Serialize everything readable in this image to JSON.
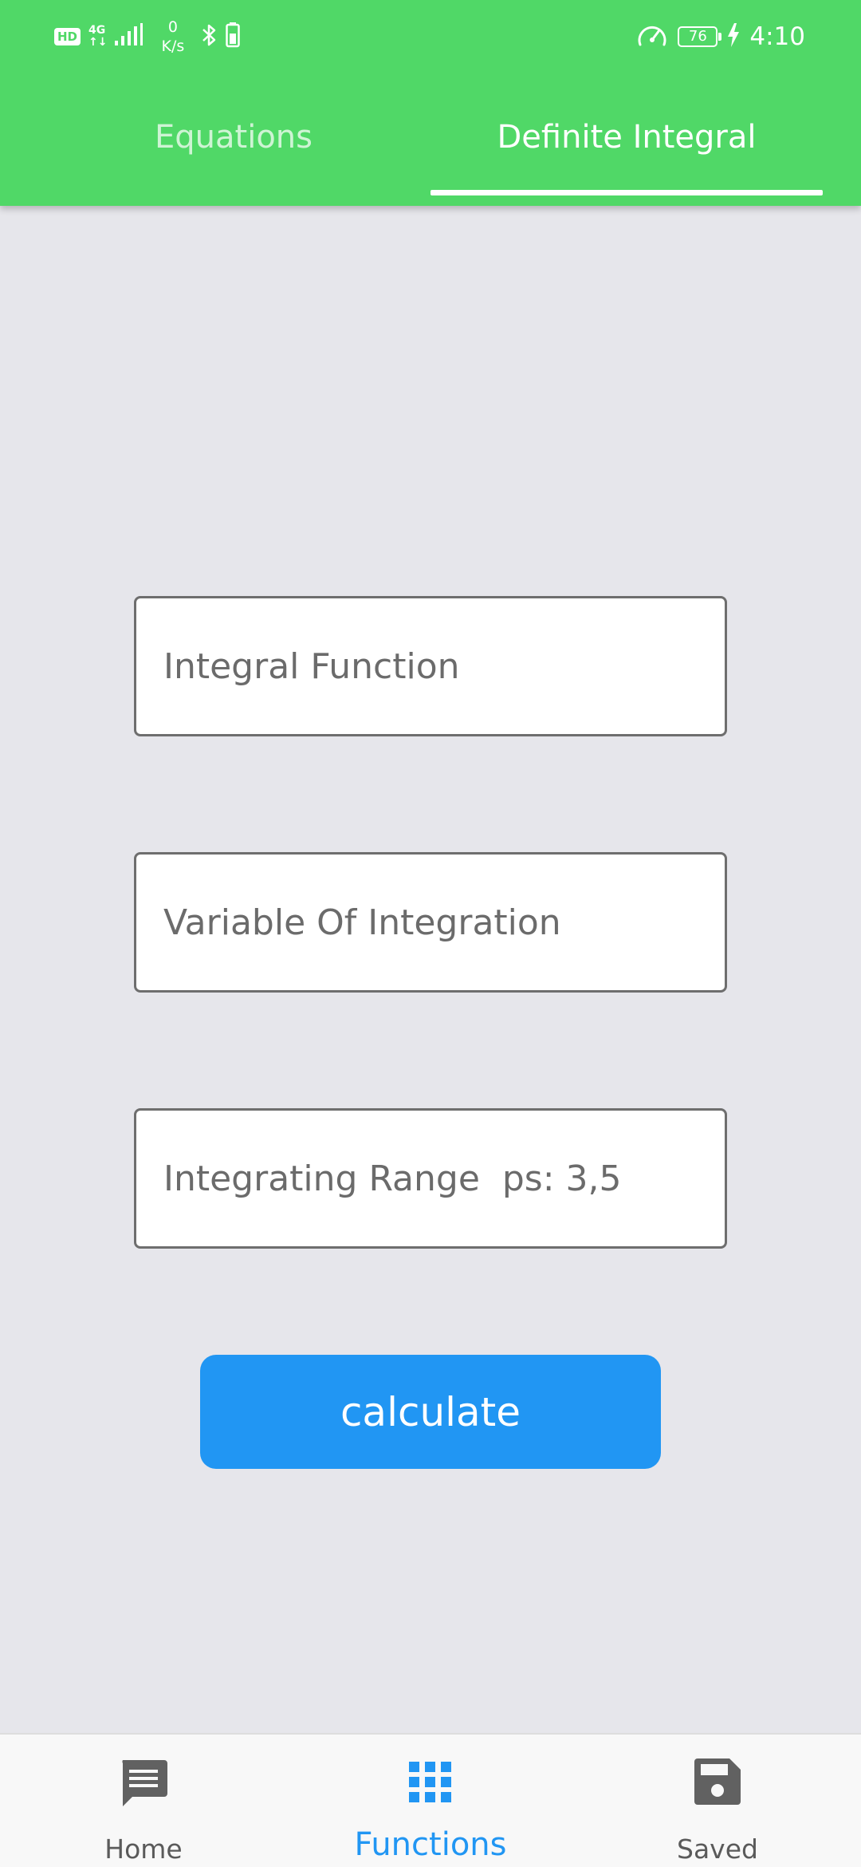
{
  "status_bar": {
    "hd": "HD",
    "network_type_top": "4G",
    "network_type_bottom": "↑↓",
    "speed_value": "0",
    "speed_unit": "K/s",
    "battery_level": "76",
    "time": "4:10"
  },
  "tabs": [
    {
      "label": "Equations",
      "selected": false
    },
    {
      "label": "Definite Integral",
      "selected": true
    }
  ],
  "form": {
    "integral_function": {
      "placeholder": "Integral Function",
      "value": ""
    },
    "variable_of_integration": {
      "placeholder": "Variable Of Integration",
      "value": ""
    },
    "integrating_range": {
      "placeholder": "Integrating Range  ps: 3,5",
      "value": ""
    },
    "calculate_label": "calculate"
  },
  "bottom_nav": {
    "items": [
      {
        "label": "Home",
        "icon": "message-icon",
        "selected": false
      },
      {
        "label": "Functions",
        "icon": "grid-icon",
        "selected": true
      },
      {
        "label": "Saved",
        "icon": "save-icon",
        "selected": false
      }
    ]
  },
  "colors": {
    "header_green": "#50d867",
    "accent_blue": "#2196f3",
    "background": "#e6e6eb",
    "nav_inactive": "#5a5a5a"
  }
}
